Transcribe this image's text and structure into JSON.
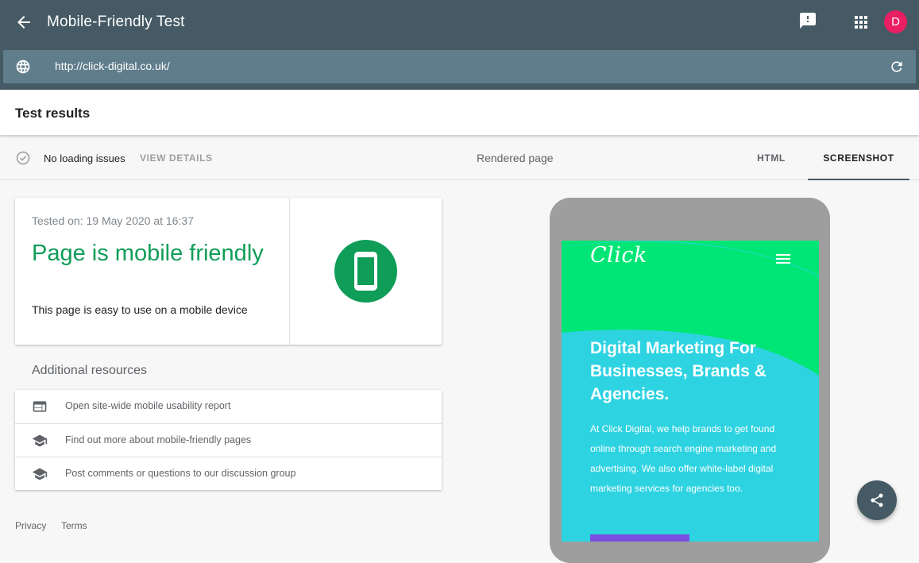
{
  "header": {
    "title": "Mobile-Friendly Test",
    "avatar_initial": "D",
    "back_icon": "arrow-back-icon",
    "feedback_icon": "feedback-icon",
    "apps_icon": "apps-grid-icon",
    "accent_color": "#455a64",
    "avatar_color": "#e91e63"
  },
  "urlbar": {
    "url": "http://click-digital.co.uk/",
    "globe_icon": "globe-icon",
    "reload_icon": "reload-icon"
  },
  "results": {
    "title": "Test results"
  },
  "status": {
    "loading_text": "No loading issues",
    "view_details": "VIEW DETAILS",
    "rendered_label": "Rendered page",
    "tabs": [
      {
        "label": "HTML",
        "active": false
      },
      {
        "label": "SCREENSHOT",
        "active": true
      }
    ]
  },
  "card": {
    "tested_on": "Tested on: 19 May 2020 at 16:37",
    "verdict": "Page is mobile friendly",
    "description": "This page is easy to use on a mobile device",
    "verdict_color": "#0f9d58",
    "badge_icon": "smartphone-icon"
  },
  "resources": {
    "title": "Additional resources",
    "items": [
      {
        "label": "Open site-wide mobile usability report",
        "icon": "web-report-icon"
      },
      {
        "label": "Find out more about mobile-friendly pages",
        "icon": "school-icon"
      },
      {
        "label": "Post comments or questions to our discussion group",
        "icon": "school-icon"
      }
    ]
  },
  "footer": {
    "privacy": "Privacy",
    "terms": "Terms"
  },
  "preview": {
    "logo": "Click",
    "headline": "Digital Marketing For Businesses, Brands & Agencies.",
    "body": "At Click Digital, we help brands to get found online through search engine marketing and advertising. We also offer white-label digital marketing services for agencies too.",
    "colors": {
      "green": "#00e676",
      "cyan": "#2ed3e1",
      "button": "#7b4fe0",
      "bezel": "#9e9e9e"
    }
  },
  "fab": {
    "icon": "share-icon"
  }
}
